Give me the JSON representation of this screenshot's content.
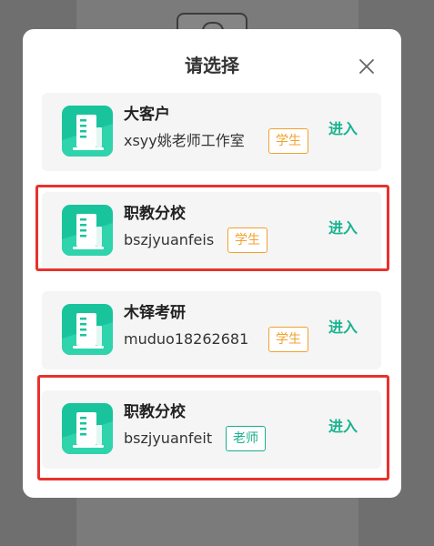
{
  "modal": {
    "title": "请选择"
  },
  "colors": {
    "accent": "#19b38f",
    "student_badge": "#f4a12d",
    "teacher_badge": "#19b08c",
    "highlight": "#e8322d",
    "card_background": "#f5f5f5"
  },
  "icons": {
    "close": "close-icon",
    "school": "building-icon"
  },
  "schools": [
    {
      "name": "大客户",
      "account": "xsyy姚老师工作室",
      "role": "学生",
      "action": "进入",
      "highlighted": false
    },
    {
      "name": "职教分校",
      "account": "bszjyuanfeis",
      "role": "学生",
      "action": "进入",
      "highlighted": true
    },
    {
      "name": "木铎考研",
      "account": "muduo18262681",
      "role": "学生",
      "action": "进入",
      "highlighted": false
    },
    {
      "name": "职教分校",
      "account": "bszjyuanfeit",
      "role": "老师",
      "action": "进入",
      "highlighted": true
    }
  ]
}
